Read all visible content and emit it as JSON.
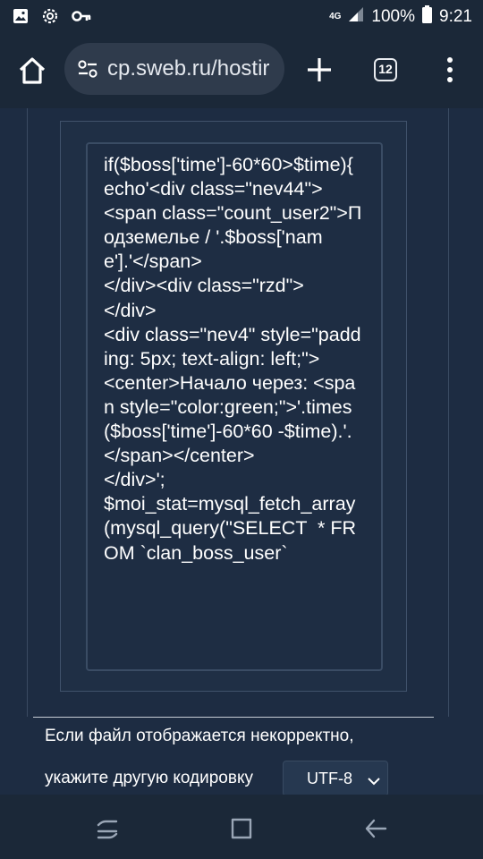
{
  "status_bar": {
    "network": "4G",
    "battery": "100%",
    "time": "9:21",
    "icons": [
      "gallery-icon",
      "gear-icon",
      "key-icon",
      "signal-icon",
      "battery-icon"
    ]
  },
  "browser": {
    "url": "cp.sweb.ru/hostir",
    "tab_count": "12"
  },
  "code": {
    "text": "if($boss['time']-60*60>$time){\necho'<div class=\"nev44\">\n<span class=\"count_user2\">Подземелье / '.$boss['name'].'</span>\n</div><div class=\"rzd\">\n</div>\n<div class=\"nev4\" style=\"padding: 5px; text-align: left;\">\n<center>Начало через: <span style=\"color:green;\">'.times($boss['time']-60*60 -$time).'.</span></center>\n</div>';\n$moi_stat=mysql_fetch_array(mysql_query(\"SELECT  * FROM `clan_boss_user`"
  },
  "encoding": {
    "line1": "Если файл отображается некорректно,",
    "line2": "укажите другую кодировку",
    "selected": "UTF-8"
  },
  "colors": {
    "background": "#1d2c42",
    "bar": "#1b2838",
    "url_pill": "#2f3b4c"
  }
}
